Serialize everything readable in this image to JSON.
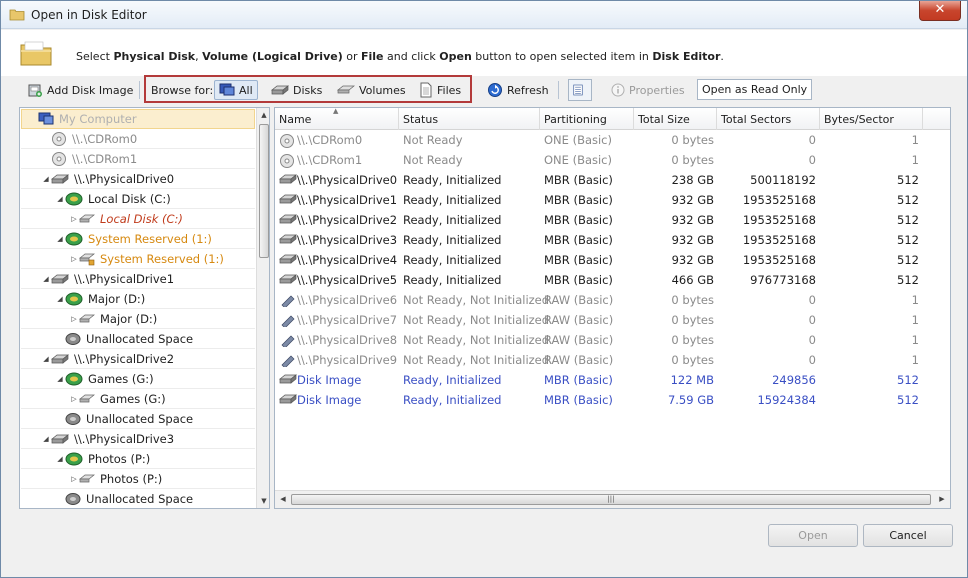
{
  "window": {
    "title": "Open in Disk Editor",
    "close_label": "✕"
  },
  "header": {
    "parts": [
      "Select ",
      "Physical Disk",
      ", ",
      "Volume (Logical Drive)",
      " or ",
      "File",
      " and click ",
      "Open",
      " button to open selected item in ",
      "Disk Editor",
      "."
    ]
  },
  "toolbar": {
    "add_disk_image": "Add Disk Image",
    "browse_for": "Browse for:",
    "all": "All",
    "disks": "Disks",
    "volumes": "Volumes",
    "files": "Files",
    "refresh": "Refresh",
    "properties": "Properties",
    "open_read_only": "Open as Read Only"
  },
  "tree": [
    {
      "label": "My Computer",
      "level": 0,
      "expander": "",
      "icon": "computer",
      "color": "#b0b0b0",
      "selected": true
    },
    {
      "label": "\\\\.\\CDRom0",
      "level": 1,
      "expander": "",
      "icon": "cd",
      "color": "#8a8a8a"
    },
    {
      "label": "\\\\.\\CDRom1",
      "level": 1,
      "expander": "",
      "icon": "cd",
      "color": "#8a8a8a"
    },
    {
      "label": "\\\\.\\PhysicalDrive0",
      "level": 1,
      "expander": "◢",
      "icon": "disk",
      "color": "#1e1e1e"
    },
    {
      "label": "Local Disk (C:)",
      "level": 2,
      "expander": "◢",
      "icon": "volume",
      "color": "#1e1e1e"
    },
    {
      "label": "Local Disk (C:)",
      "level": 3,
      "expander": "▷",
      "icon": "part",
      "color": "#c03b1b",
      "italic": true
    },
    {
      "label": "System Reserved (1:)",
      "level": 2,
      "expander": "◢",
      "icon": "volume",
      "color": "#d68910"
    },
    {
      "label": "System Reserved (1:)",
      "level": 3,
      "expander": "▷",
      "icon": "part-lock",
      "color": "#d68910"
    },
    {
      "label": "\\\\.\\PhysicalDrive1",
      "level": 1,
      "expander": "◢",
      "icon": "disk",
      "color": "#1e1e1e"
    },
    {
      "label": "Major (D:)",
      "level": 2,
      "expander": "◢",
      "icon": "volume",
      "color": "#1e1e1e"
    },
    {
      "label": "Major (D:)",
      "level": 3,
      "expander": "▷",
      "icon": "part",
      "color": "#1e1e1e"
    },
    {
      "label": "Unallocated Space",
      "level": 2,
      "expander": "",
      "icon": "unalloc",
      "color": "#1e1e1e"
    },
    {
      "label": "\\\\.\\PhysicalDrive2",
      "level": 1,
      "expander": "◢",
      "icon": "disk",
      "color": "#1e1e1e"
    },
    {
      "label": "Games (G:)",
      "level": 2,
      "expander": "◢",
      "icon": "volume",
      "color": "#1e1e1e"
    },
    {
      "label": "Games (G:)",
      "level": 3,
      "expander": "▷",
      "icon": "part",
      "color": "#1e1e1e"
    },
    {
      "label": "Unallocated Space",
      "level": 2,
      "expander": "",
      "icon": "unalloc",
      "color": "#1e1e1e"
    },
    {
      "label": "\\\\.\\PhysicalDrive3",
      "level": 1,
      "expander": "◢",
      "icon": "disk",
      "color": "#1e1e1e"
    },
    {
      "label": "Photos (P:)",
      "level": 2,
      "expander": "◢",
      "icon": "volume",
      "color": "#1e1e1e"
    },
    {
      "label": "Photos (P:)",
      "level": 3,
      "expander": "▷",
      "icon": "part",
      "color": "#1e1e1e"
    },
    {
      "label": "Unallocated Space",
      "level": 2,
      "expander": "",
      "icon": "unalloc",
      "color": "#1e1e1e"
    }
  ],
  "columns": [
    "Name",
    "Status",
    "Partitioning",
    "Total Size",
    "Total Sectors",
    "Bytes/Sector"
  ],
  "rows": [
    {
      "name": "\\\\.\\CDRom0",
      "status": "Not Ready",
      "partitioning": "ONE (Basic)",
      "size": "0 bytes",
      "sectors": "0",
      "bps": "1",
      "kind": "cd",
      "color": "#8a8a8a"
    },
    {
      "name": "\\\\.\\CDRom1",
      "status": "Not Ready",
      "partitioning": "ONE (Basic)",
      "size": "0 bytes",
      "sectors": "0",
      "bps": "1",
      "kind": "cd",
      "color": "#8a8a8a"
    },
    {
      "name": "\\\\.\\PhysicalDrive0",
      "status": "Ready, Initialized",
      "partitioning": "MBR (Basic)",
      "size": "238 GB",
      "sectors": "500118192",
      "bps": "512",
      "kind": "disk",
      "color": "#1e1e1e"
    },
    {
      "name": "\\\\.\\PhysicalDrive1",
      "status": "Ready, Initialized",
      "partitioning": "MBR (Basic)",
      "size": "932 GB",
      "sectors": "1953525168",
      "bps": "512",
      "kind": "disk",
      "color": "#1e1e1e"
    },
    {
      "name": "\\\\.\\PhysicalDrive2",
      "status": "Ready, Initialized",
      "partitioning": "MBR (Basic)",
      "size": "932 GB",
      "sectors": "1953525168",
      "bps": "512",
      "kind": "disk",
      "color": "#1e1e1e"
    },
    {
      "name": "\\\\.\\PhysicalDrive3",
      "status": "Ready, Initialized",
      "partitioning": "MBR (Basic)",
      "size": "932 GB",
      "sectors": "1953525168",
      "bps": "512",
      "kind": "disk",
      "color": "#1e1e1e"
    },
    {
      "name": "\\\\.\\PhysicalDrive4",
      "status": "Ready, Initialized",
      "partitioning": "MBR (Basic)",
      "size": "932 GB",
      "sectors": "1953525168",
      "bps": "512",
      "kind": "disk",
      "color": "#1e1e1e"
    },
    {
      "name": "\\\\.\\PhysicalDrive5",
      "status": "Ready, Initialized",
      "partitioning": "MBR (Basic)",
      "size": "466 GB",
      "sectors": "976773168",
      "bps": "512",
      "kind": "disk",
      "color": "#1e1e1e"
    },
    {
      "name": "\\\\.\\PhysicalDrive6",
      "status": "Not Ready, Not Initialized",
      "partitioning": "RAW (Basic)",
      "size": "0 bytes",
      "sectors": "0",
      "bps": "1",
      "kind": "usb",
      "color": "#8a8a8a"
    },
    {
      "name": "\\\\.\\PhysicalDrive7",
      "status": "Not Ready, Not Initialized",
      "partitioning": "RAW (Basic)",
      "size": "0 bytes",
      "sectors": "0",
      "bps": "1",
      "kind": "usb",
      "color": "#8a8a8a"
    },
    {
      "name": "\\\\.\\PhysicalDrive8",
      "status": "Not Ready, Not Initialized",
      "partitioning": "RAW (Basic)",
      "size": "0 bytes",
      "sectors": "0",
      "bps": "1",
      "kind": "usb",
      "color": "#8a8a8a"
    },
    {
      "name": "\\\\.\\PhysicalDrive9",
      "status": "Not Ready, Not Initialized",
      "partitioning": "RAW (Basic)",
      "size": "0 bytes",
      "sectors": "0",
      "bps": "1",
      "kind": "usb",
      "color": "#8a8a8a"
    },
    {
      "name": "Disk Image",
      "status": "Ready, Initialized",
      "partitioning": "MBR (Basic)",
      "size": "122 MB",
      "sectors": "249856",
      "bps": "512",
      "kind": "image",
      "color": "#3a4fc4"
    },
    {
      "name": "Disk Image",
      "status": "Ready, Initialized",
      "partitioning": "MBR (Basic)",
      "size": "7.59 GB",
      "sectors": "15924384",
      "bps": "512",
      "kind": "image",
      "color": "#3a4fc4"
    }
  ],
  "buttons": {
    "open": "Open",
    "cancel": "Cancel"
  }
}
